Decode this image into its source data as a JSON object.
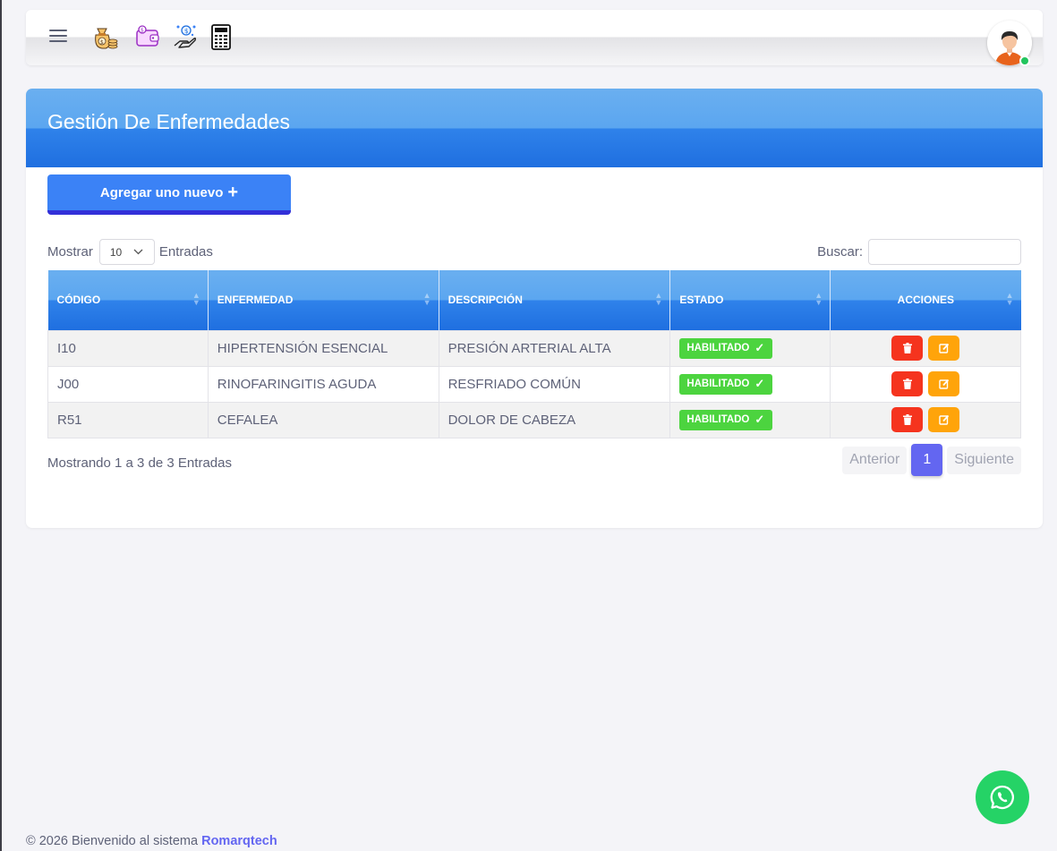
{
  "topbar": {
    "menu_icon": "hamburger-icon",
    "quick_icons": [
      "money-bag-icon",
      "wallet-icon",
      "payment-hand-icon",
      "calculator-icon"
    ],
    "avatar_icon": "user-avatar-icon",
    "status": "online"
  },
  "page": {
    "title": "Gestión De Enfermedades",
    "add_button_label": "Agregar uno nuevo"
  },
  "table_controls": {
    "show_label": "Mostrar",
    "page_length": "10",
    "entries_label": "Entradas",
    "search_label": "Buscar:",
    "search_value": ""
  },
  "table": {
    "headers": [
      "CÓDIGO",
      "ENFERMEDAD",
      "DESCRIPCIÓN",
      "ESTADO",
      "ACCIONES"
    ],
    "rows": [
      {
        "code": "I10",
        "disease": "HIPERTENSIÓN ESENCIAL",
        "description": "PRESIÓN ARTERIAL ALTA",
        "status": "HABILITADO"
      },
      {
        "code": "J00",
        "disease": "RINOFARINGITIS AGUDA",
        "description": "RESFRIADO COMÚN",
        "status": "HABILITADO"
      },
      {
        "code": "R51",
        "disease": "CEFALEA",
        "description": "DOLOR DE CABEZA",
        "status": "HABILITADO"
      }
    ]
  },
  "pagination": {
    "info": "Mostrando 1 a 3 de 3 Entradas",
    "previous": "Anterior",
    "current_page": "1",
    "next": "Siguiente"
  },
  "footer": {
    "text": "© 2026 Bienvenido al sistema",
    "brand": "Romarqtech"
  },
  "colors": {
    "primary": "#3b82f6",
    "header_gradient_top": "#6aaff0",
    "header_gradient_bottom": "#1f6fe0",
    "status_enabled": "#4cd43f",
    "delete": "#f5341e",
    "edit": "#ffa40a",
    "page_active": "#6366f1",
    "whatsapp": "#25d366"
  }
}
